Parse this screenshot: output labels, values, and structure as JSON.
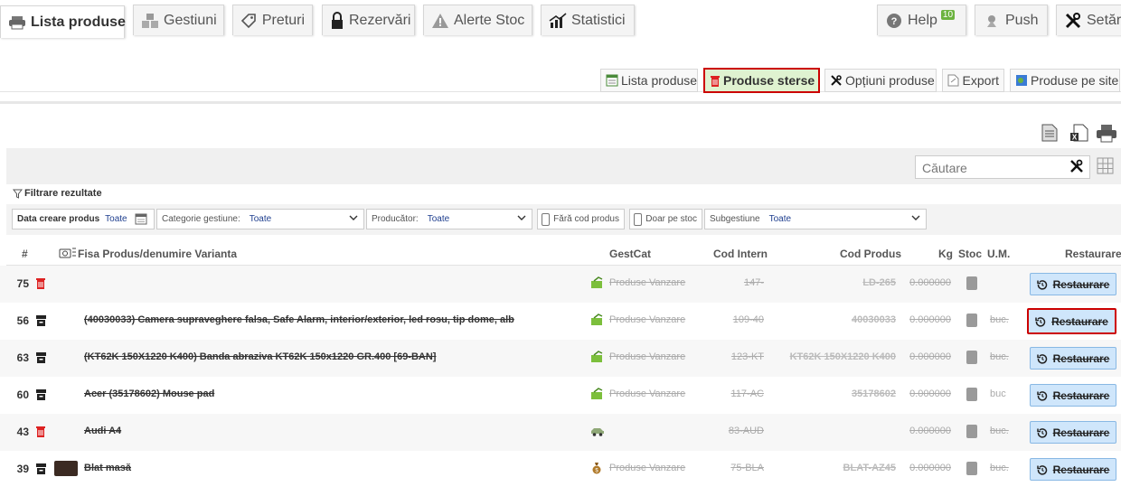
{
  "top_tabs": [
    {
      "label": "Lista produse",
      "icon": "printer-icon",
      "active": true
    },
    {
      "label": "Gestiuni",
      "icon": "boxes-icon"
    },
    {
      "label": "Preturi",
      "icon": "price-tag-icon"
    },
    {
      "label": "Rezervări",
      "icon": "lock-icon"
    },
    {
      "label": "Alerte Stoc",
      "icon": "warning-icon"
    },
    {
      "label": "Statistici",
      "icon": "chart-icon"
    },
    {
      "label": "Help",
      "icon": "help-icon",
      "badge": "10"
    },
    {
      "label": "Push",
      "icon": "push-icon"
    },
    {
      "label": "Setări",
      "icon": "tools-icon"
    }
  ],
  "sub_tabs": [
    {
      "label": "Lista produse",
      "icon": "list-icon"
    },
    {
      "label": "Produse sterse",
      "icon": "trash-icon",
      "active": true
    },
    {
      "label": "Opțiuni produse",
      "icon": "tools-icon"
    },
    {
      "label": "Export",
      "icon": "export-icon"
    },
    {
      "label": "Produse pe site",
      "icon": "globe-icon"
    }
  ],
  "search": {
    "placeholder": "Căutare"
  },
  "filters": {
    "title": "Filtrare rezultate",
    "date_label": "Data creare produs",
    "date_value": "Toate",
    "category_label": "Categorie gestiune:",
    "category_value": "Toate",
    "producer_label": "Producător:",
    "producer_value": "Toate",
    "no_code_label": "Fără cod produs",
    "in_stock_label": "Doar pe stoc",
    "subgestiune_label": "Subgestiune",
    "subgestiune_value": "Toate"
  },
  "table": {
    "headers": {
      "num": "#",
      "name": "Fisa Produs/denumire Varianta",
      "gestcat": "GestCat",
      "cod_intern": "Cod Intern",
      "cod_produs": "Cod Produs",
      "kg": "Kg",
      "stoc": "Stoc",
      "um": "U.M.",
      "restore": "Restaurare"
    },
    "rows": [
      {
        "num": "75",
        "icon": "trash-icon",
        "name": "",
        "gestcat": "Produse Vanzare",
        "cod_intern": "147-",
        "cod_produs": "LD-265",
        "kg": "0.000000",
        "um": "",
        "restore": "Restaurare"
      },
      {
        "num": "56",
        "icon": "archive-icon",
        "name": "(40030033) Camera supraveghere falsa, Safe Alarm, interior/exterior, led rosu, tip dome, alb",
        "gestcat": "Produse Vanzare",
        "cod_intern": "109-40",
        "cod_produs": "40030033",
        "kg": "0.000000",
        "um": "buc.",
        "restore": "Restaurare",
        "highlight": true
      },
      {
        "num": "63",
        "icon": "archive-icon",
        "name": "(KT62K 150X1220 K400) Banda abraziva KT62K 150x1220 GR.400 [69-BAN]",
        "gestcat": "Produse Vanzare",
        "cod_intern": "123-KT",
        "cod_produs": "KT62K 150X1220 K400",
        "kg": "0.000000",
        "um": "buc.",
        "restore": "Restaurare"
      },
      {
        "num": "60",
        "icon": "archive-icon",
        "name": "Acer (35178602) Mouse pad",
        "gestcat": "Produse Vanzare",
        "cod_intern": "117-AC",
        "cod_produs": "35178602",
        "kg": "0.000000",
        "um": "buc",
        "restore": "Restaurare"
      },
      {
        "num": "43",
        "icon": "trash-icon",
        "name": "Audi A4",
        "gestcat": "",
        "gestcat_icon": "car-icon",
        "cod_intern": "83-AUD",
        "cod_produs": "",
        "kg": "0.000000",
        "um": "buc.",
        "restore": "Restaurare"
      },
      {
        "num": "39",
        "icon": "archive-icon",
        "name": "Blat masă",
        "gestcat": "Produse Vanzare",
        "gestcat_icon": "moneybag-icon",
        "thumb": true,
        "cod_intern": "75-BLA",
        "cod_produs": "BLAT-AZ45",
        "kg": "0.000000",
        "um": "buc.",
        "restore": "Restaurare"
      }
    ]
  }
}
